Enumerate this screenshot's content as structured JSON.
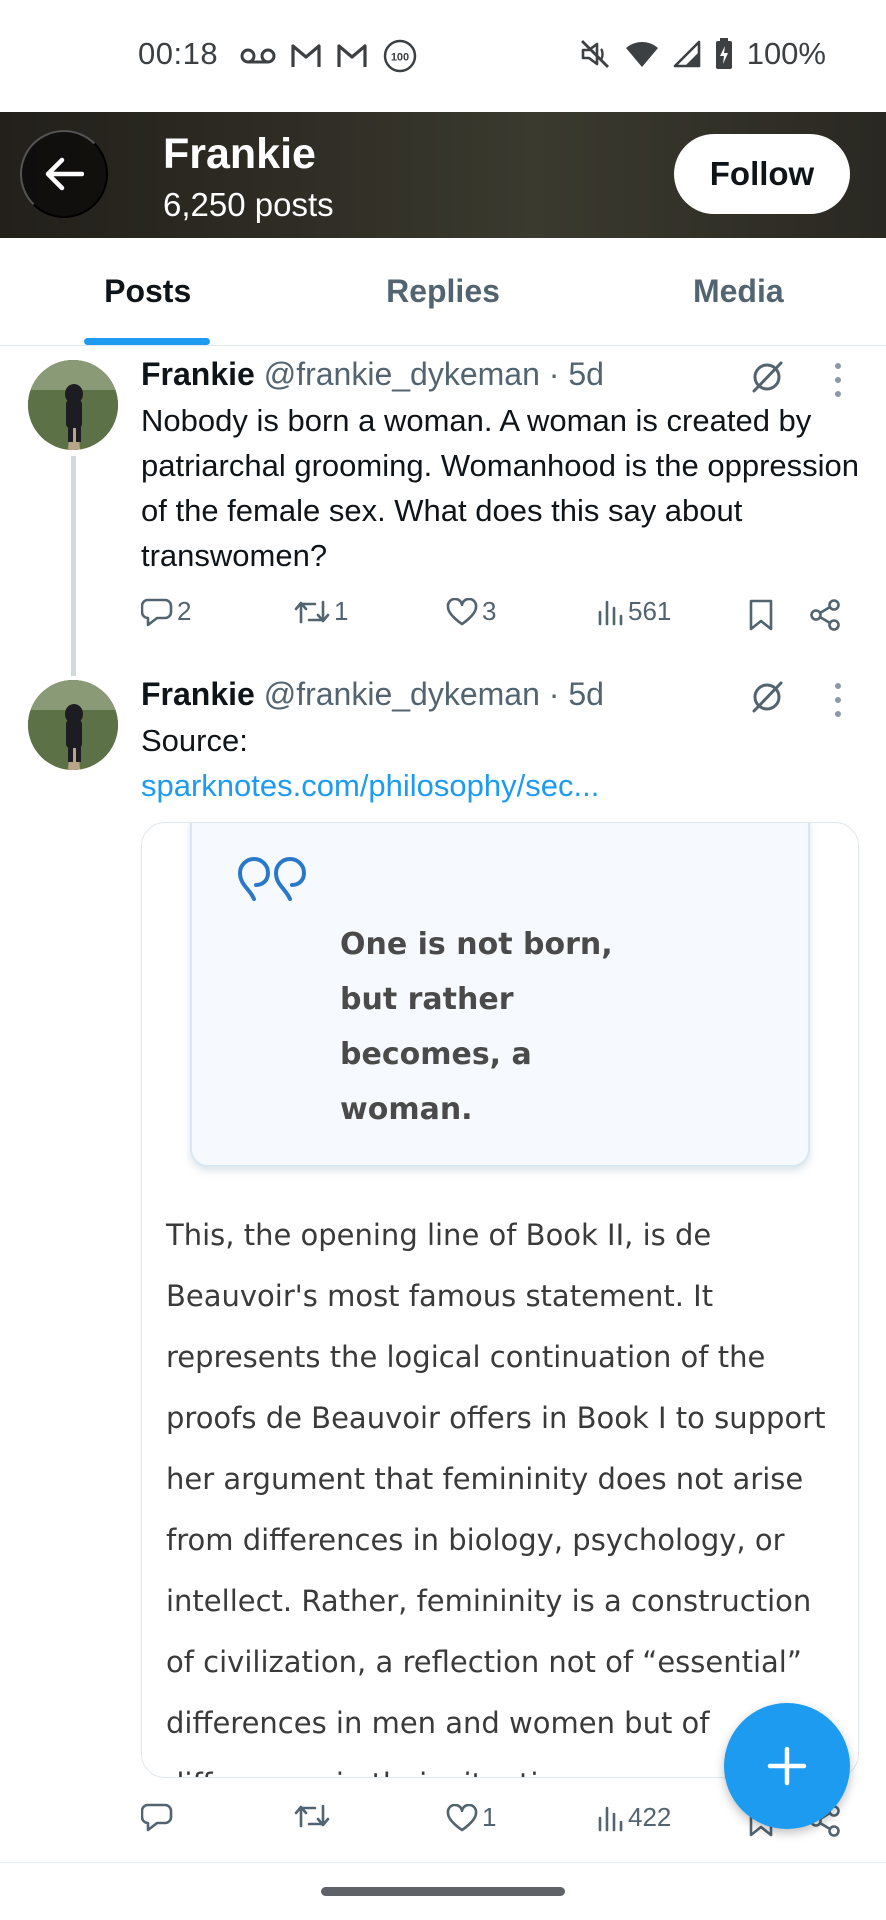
{
  "status_bar": {
    "time": "00:18",
    "battery_text": "100%",
    "left_icons": [
      "voicemail-icon",
      "gmail-icon",
      "gmail-icon",
      "notification-count-icon"
    ],
    "notification_count": "100",
    "right_icons": [
      "mute-icon",
      "wifi-icon",
      "signal-icon",
      "battery-charging-icon"
    ]
  },
  "header": {
    "name": "Frankie",
    "post_count": "6,250 posts",
    "follow_label": "Follow"
  },
  "tabs": [
    {
      "label": "Posts",
      "active": true
    },
    {
      "label": "Replies",
      "active": false
    },
    {
      "label": "Media",
      "active": false
    }
  ],
  "posts": [
    {
      "name": "Frankie",
      "meta": "@frankie_dykeman · 5d",
      "text": "Nobody is born a woman. A woman is created by patriarchal grooming. Womanhood is the oppression of the female sex. What does this say about transwomen?",
      "replies": "2",
      "reposts": "1",
      "likes": "3",
      "views": "561"
    },
    {
      "name": "Frankie",
      "meta": "@frankie_dykeman · 5d",
      "text": "Source:",
      "link": "sparknotes.com/philosophy/sec...",
      "replies": "",
      "reposts": "",
      "likes": "1",
      "views": "422",
      "card": {
        "quote": "One is not born, but rather becomes, a woman.",
        "body": "This, the opening line of Book II, is de Beauvoir's most famous statement. It represents the logical continuation of the proofs de Beauvoir offers in Book I to support her argument that femininity does not arise from differences in biology, psychology, or intellect. Rather, femininity is a construction of civilization, a reflection not of “essential” differences in men and women but of differences in their situation."
      }
    }
  ],
  "colors": {
    "accent": "#1d9bf0",
    "text_primary": "#0f1419",
    "text_secondary": "#536471"
  }
}
